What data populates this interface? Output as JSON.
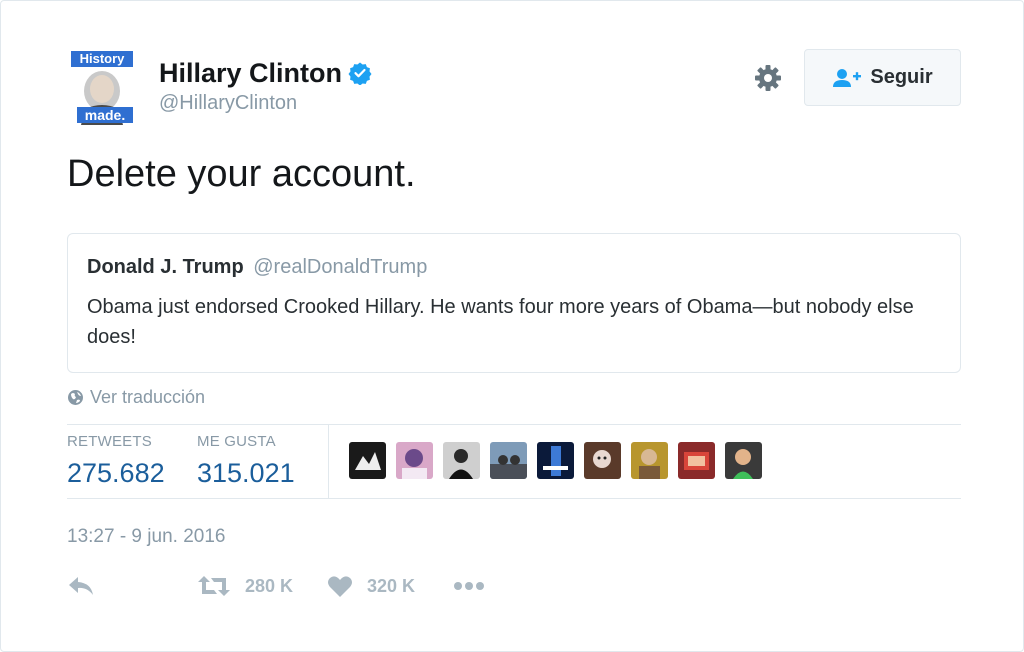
{
  "user": {
    "name": "Hillary Clinton",
    "screen_name": "@HillaryClinton",
    "avatar_text_top": "History",
    "avatar_text_bottom": "made."
  },
  "follow_button": {
    "label": "Seguir"
  },
  "tweet": {
    "text": "Delete your account."
  },
  "quoted_tweet": {
    "name": "Donald J. Trump",
    "screen_name": "@realDonaldTrump",
    "text": "Obama just endorsed Crooked Hillary. He wants four more years of Obama—but nobody else does!"
  },
  "translate_link": "Ver traducción",
  "stats": {
    "retweets_label": "RETWEETS",
    "retweets_value": "275.682",
    "likes_label": "ME GUSTA",
    "likes_value": "315.021"
  },
  "timestamp": "13:27 - 9 jun. 2016",
  "actions": {
    "retweet_count": "280 K",
    "like_count": "320 K"
  },
  "colors": {
    "link_blue": "#1b5e9b",
    "verified_blue": "#1da1f2",
    "muted": "#8899a6",
    "icon_grey": "#aab8c2"
  },
  "icons": {
    "verified": "verified-badge-icon",
    "settings": "gear-icon",
    "follow": "add-user-icon",
    "globe": "globe-icon",
    "reply": "reply-icon",
    "retweet": "retweet-icon",
    "like": "heart-icon",
    "more": "more-dots-icon"
  }
}
